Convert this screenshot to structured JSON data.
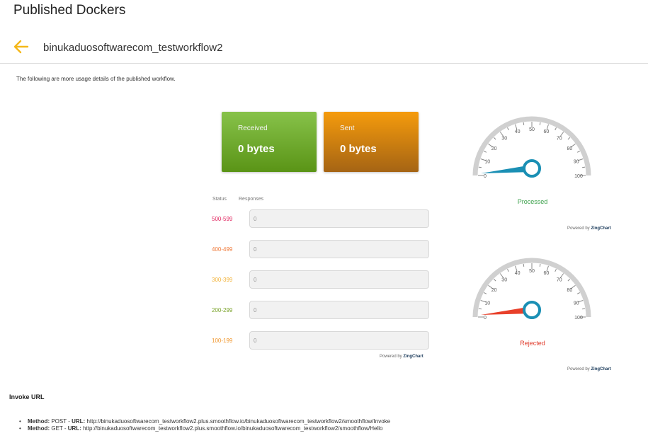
{
  "header": {
    "title": "Published Dockers",
    "workflow_name": "binukaduosoftwarecom_testworkflow2"
  },
  "description": "The following are more usage details of the published workflow.",
  "cards": {
    "received": {
      "label": "Received",
      "value": "0 bytes"
    },
    "sent": {
      "label": "Sent",
      "value": "0 bytes"
    }
  },
  "responses": {
    "status_header": "Status",
    "responses_header": "Responses",
    "rows": [
      {
        "status": "500-599",
        "value": "0",
        "color": "#e0245e"
      },
      {
        "status": "400-499",
        "value": "0",
        "color": "#ef7a3a"
      },
      {
        "status": "300-399",
        "value": "0",
        "color": "#f2b33a"
      },
      {
        "status": "200-299",
        "value": "0",
        "color": "#7aa32a"
      },
      {
        "status": "100-199",
        "value": "0",
        "color": "#f0952a"
      }
    ]
  },
  "powered_by": {
    "prefix": "Powered by",
    "brand": "ZingChart"
  },
  "gauges": [
    {
      "caption": "Processed",
      "caption_color": "#3aa04a",
      "needle_color": "#1a8fb4",
      "value": 0,
      "ticks": [
        "0",
        "10",
        "20",
        "30",
        "40",
        "50",
        "60",
        "70",
        "80",
        "90",
        "100"
      ]
    },
    {
      "caption": "Rejected",
      "caption_color": "#e03a2a",
      "needle_color": "#e8402a",
      "value": 0,
      "ticks": [
        "0",
        "10",
        "20",
        "30",
        "40",
        "50",
        "60",
        "70",
        "80",
        "90",
        "100"
      ]
    }
  ],
  "invoke": {
    "title": "Invoke URL",
    "methods": [
      {
        "method_label": "Method:",
        "method": "POST",
        "url_label": "URL:",
        "url": "http://binukaduosoftwarecom_testworkflow2.plus.smoothflow.io/binukaduosoftwarecom_testworkflow2/smoothflow/Invoke"
      },
      {
        "method_label": "Method:",
        "method": "GET",
        "url_label": "URL:",
        "url": "http://binukaduosoftwarecom_testworkflow2.plus.smoothflow.io/binukaduosoftwarecom_testworkflow2/smoothflow/Hello"
      }
    ]
  },
  "colors": {
    "accent": "#f5b81a"
  }
}
